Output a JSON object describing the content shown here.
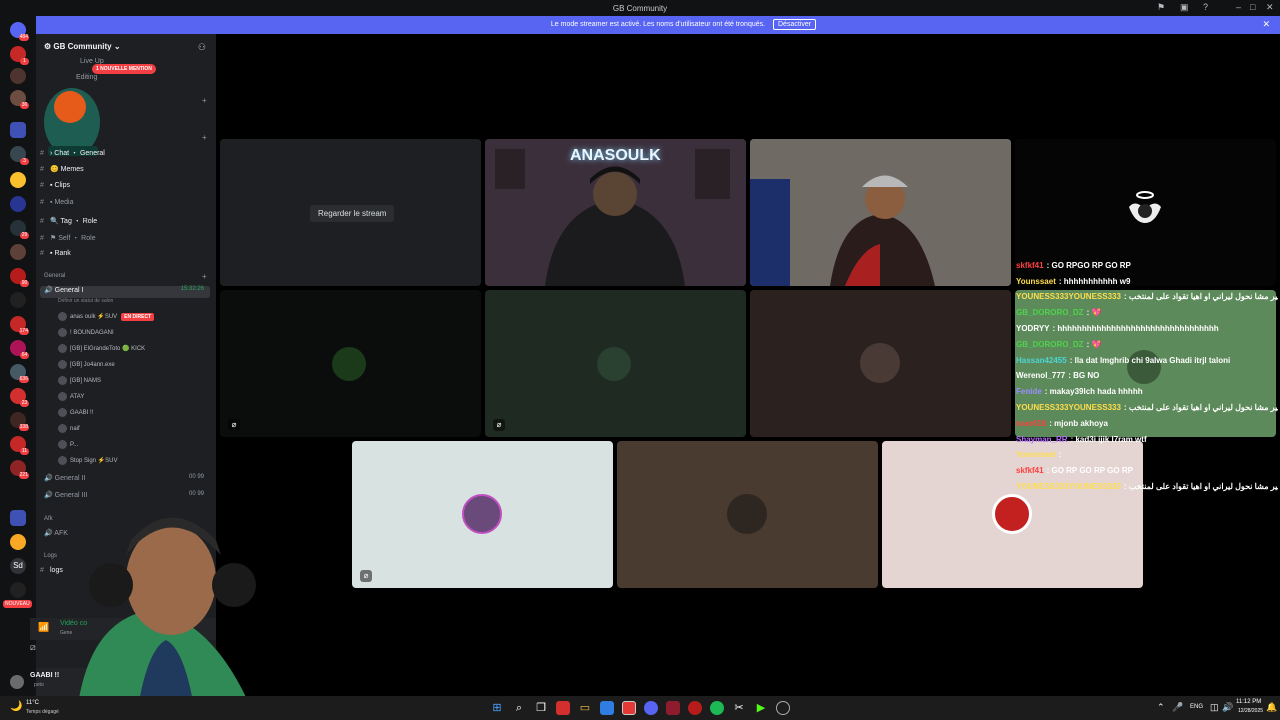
{
  "window": {
    "title": "GB Community"
  },
  "banner": {
    "text": "Le mode streamer est activé. Les noms d'utilisateur ont été tronqués.",
    "button": "Désactiver"
  },
  "server_badges": [
    "484",
    "1",
    "36",
    "3",
    "29",
    "90",
    "174",
    "64",
    "636",
    "23",
    "338",
    "11",
    "221"
  ],
  "server_labels": {
    "sd": "Sd",
    "new": "NOUVEAU"
  },
  "guild": {
    "name": "GB Community",
    "mention_pill": "1 NOUVELLE MENTION"
  },
  "channels": [
    {
      "name": "Live Up",
      "bright": false
    },
    {
      "name": "Editing",
      "bright": false
    },
    {
      "name": "Chat ・ General",
      "bright": true
    },
    {
      "name": "Memes",
      "bright": true
    },
    {
      "name": "Clips",
      "bright": true
    },
    {
      "name": "Media",
      "bright": false
    },
    {
      "name": "Tag ・ Role",
      "bright": true
    },
    {
      "name": "Self ・ Role",
      "bright": false
    },
    {
      "name": "Rank",
      "bright": true
    }
  ],
  "voice_category": "General",
  "voice_channel": {
    "name": "General I",
    "timer": "15:32:26",
    "status": "Définir un statut de salon"
  },
  "voice_users": [
    {
      "name": "anas oulk ⚡SUV",
      "live": "EN DIRECT"
    },
    {
      "name": "! BOUNDAGANI",
      "live": ""
    },
    {
      "name": "[GB] ElGrandeToto 🟢 KICK",
      "live": ""
    },
    {
      "name": "[GB] Jo4ann.exe",
      "live": ""
    },
    {
      "name": "[GB] NAMS",
      "live": ""
    },
    {
      "name": "ATAY",
      "live": ""
    },
    {
      "name": "GAABI !!",
      "live": ""
    },
    {
      "name": "naif",
      "live": ""
    },
    {
      "name": "P...",
      "live": ""
    },
    {
      "name": "Stop Sign ⚡SUV",
      "live": ""
    }
  ],
  "other_voice": [
    {
      "name": "General II",
      "count": "00 99"
    },
    {
      "name": "General III",
      "count": "00 99"
    }
  ],
  "afk_category": "Afk",
  "afk_channel": "AFK",
  "logs_category": "Logs",
  "logs_channel": "logs",
  "voice_connected": {
    "label": "Vidéo co",
    "sub": "Gene"
  },
  "user": {
    "name": "GAABI !!",
    "status": "poto"
  },
  "stream_tile": {
    "button": "Regarder le stream"
  },
  "tiles": [
    {
      "name": "tile-stream-preview",
      "bg": "#1e1f22"
    },
    {
      "name": "tile-anasoulk",
      "bg": "#3a2d3a",
      "neon": "ANASOULK"
    },
    {
      "name": "tile-webcam-2",
      "bg": "#6b6660"
    },
    {
      "name": "tile-avatar-angel",
      "bg": "#050505"
    },
    {
      "name": "tile-avatar-green",
      "bg": "#0b0c0c"
    },
    {
      "name": "tile-avatar-logo",
      "bg": "#1e2a22"
    },
    {
      "name": "tile-avatar-skull",
      "bg": "#2b221f"
    },
    {
      "name": "tile-chat",
      "bg": "#5d8a5a"
    },
    {
      "name": "tile-avatar-pink",
      "bg": "#d8e2e0"
    },
    {
      "name": "tile-avatar-person",
      "bg": "#4a3b30"
    },
    {
      "name": "tile-avatar-redcircle",
      "bg": "#e4d4d2"
    }
  ],
  "chat_messages": [
    {
      "user": "",
      "text": "",
      "color": "#ffffff"
    },
    {
      "user": "skfkf41",
      "text": ": GO RPGO RP GO RP",
      "color": "#ff4040"
    },
    {
      "user": "Younssaet",
      "text": ": hhhhhhhhhhh w9",
      "color": "#ffde4d"
    },
    {
      "user": "YOUNESS333YOUNESS333",
      "text": ": غير مشا نحول ليراني او اهيا تقواد على لمنتخب",
      "color": "#ffde4d"
    },
    {
      "user": "GB_DORORO_DZ",
      "text": ": 💖",
      "color": "#4dd44d"
    },
    {
      "user": "YODRYY",
      "text": ": hhhhhhhhhhhhhhhhhhhhhhhhhhhhhhhhh",
      "color": "#ffffff"
    },
    {
      "user": "GB_DORORO_DZ",
      "text": ": 💖",
      "color": "#4dd44d"
    },
    {
      "user": "Hassan42455",
      "text": ": lla dat lmghrib chi 9alwa Ghadi itrjl taloni",
      "color": "#4dd4d4"
    },
    {
      "user": "Werenol_777",
      "text": ": BG NO",
      "color": "#ffffff"
    },
    {
      "user": "Fenide",
      "text": ": makay39lch hada hhhhh",
      "color": "#9a8cff"
    },
    {
      "user": "YOUNESS333YOUNESS333",
      "text": ": غير مشا نحول ليراني او اهيا تقواد على لمنتخب",
      "color": "#ffde4d"
    },
    {
      "user": "nasr616",
      "text": ": mjonb akhoya",
      "color": "#ff4040"
    },
    {
      "user": "Shayman_RR",
      "text": ": kad3i ijik l7ram wtf",
      "color": "#b66dff"
    },
    {
      "user": "Younssaet",
      "text": ":",
      "color": "#ffde4d"
    },
    {
      "user": "skfkf41",
      "text": ": GO RP GO RP GO RP",
      "color": "#ff4040"
    },
    {
      "user": "YOUNESS333YOUNESS333",
      "text": ": غير مشا نحول ليراني او اهيا تقواد على لمنتخب",
      "color": "#ffde4d"
    }
  ],
  "taskbar": {
    "weather": "11°C",
    "weather_sub": "Temps dégagé",
    "lang": "ENG",
    "time": "11:12 PM",
    "date": "12/28/2025"
  }
}
